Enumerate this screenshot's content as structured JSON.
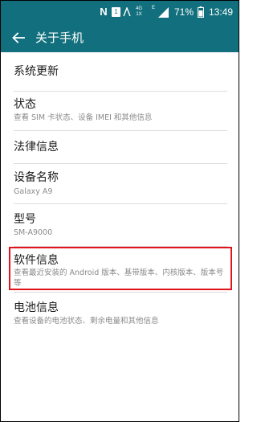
{
  "status_bar": {
    "nfc_icon": "N",
    "sim_icon": "1",
    "network_top": "4G",
    "network_bottom": "1X",
    "data_type": "E",
    "battery_percent": "71%",
    "time": "13:49"
  },
  "app_bar": {
    "title": "关于手机"
  },
  "colors": {
    "app_bar": "#12707e",
    "highlight": "#e0141b",
    "title_text": "#1b1b1b",
    "subtitle_text": "#8a8a8a"
  },
  "items": [
    {
      "title": "系统更新"
    },
    {
      "title": "状态",
      "subtitle": "查看 SIM 卡状态、设备 IMEI 和其他信息"
    },
    {
      "title": "法律信息"
    },
    {
      "title": "设备名称",
      "subtitle": "Galaxy A9"
    },
    {
      "title": "型号",
      "subtitle": "SM-A9000"
    },
    {
      "title": "软件信息",
      "subtitle": "查看最近安装的 Android 版本、基带版本、内核版本、版本号等"
    },
    {
      "title": "电池信息",
      "subtitle": "查看设备的电池状态、剩余电量和其他信息"
    }
  ]
}
